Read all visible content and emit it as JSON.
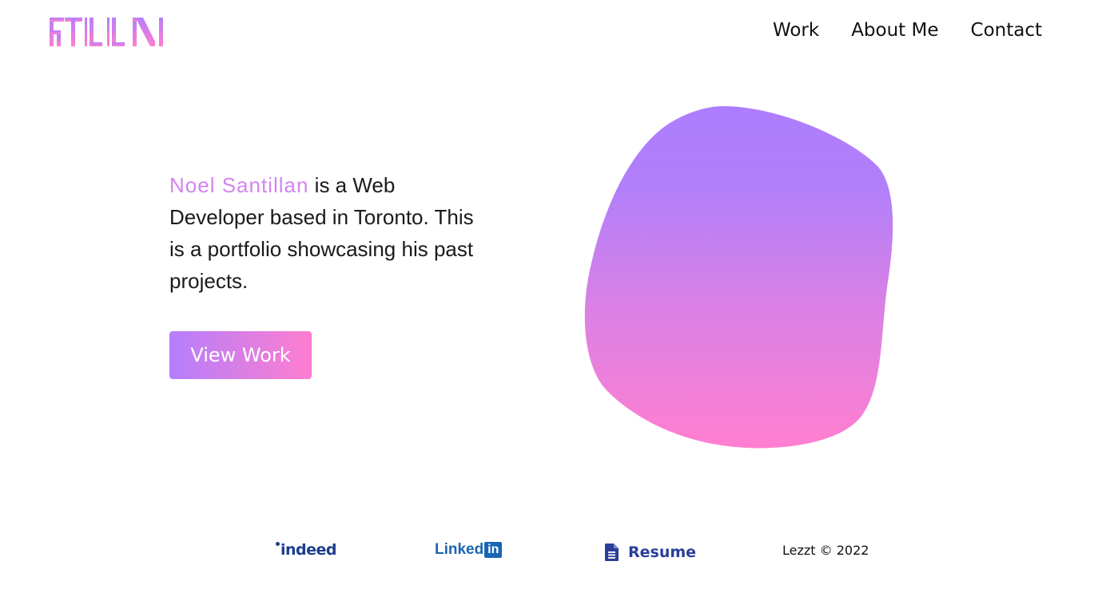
{
  "header": {
    "logo_text": "STLLN",
    "nav": [
      {
        "label": "Work"
      },
      {
        "label": "About Me"
      },
      {
        "label": "Contact"
      }
    ]
  },
  "hero": {
    "name": "Noel Santillan",
    "description": " is a Web Developer based in Toronto. This is a portfolio showcasing his past projects.",
    "cta_label": "View Work"
  },
  "footer": {
    "indeed_label": "indeed",
    "linkedin_label": "Linked",
    "linkedin_box": "in",
    "resume_label": "Resume",
    "copyright": "Lezzt © 2022"
  },
  "colors": {
    "accent_purple": "#b57efb",
    "accent_pink": "#fe7ecf",
    "name_color": "#d384ee",
    "indeed_blue": "#1d3c8f",
    "linkedin_blue": "#1a66b2",
    "resume_blue": "#2a3f9a"
  }
}
